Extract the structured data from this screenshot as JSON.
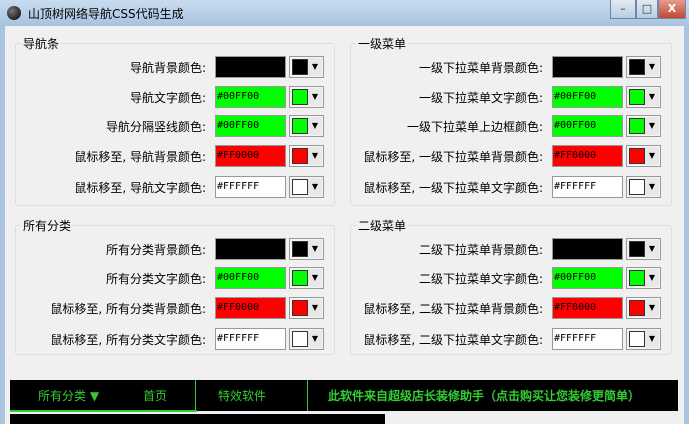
{
  "window": {
    "title": "山顶树网络导航CSS代码生成",
    "minimize": "–",
    "maximize": "□",
    "close": "X"
  },
  "groups": [
    {
      "title": "导航条",
      "rows": [
        {
          "label": "导航背景颜色:",
          "value": "",
          "color": "#000000",
          "text": "#000000"
        },
        {
          "label": "导航文字颜色:",
          "value": "#00FF00",
          "color": "#00FF00",
          "text": "#000000"
        },
        {
          "label": "导航分隔竖线颜色:",
          "value": "#00FF00",
          "color": "#00FF00",
          "text": "#000000"
        },
        {
          "label": "鼠标移至, 导航背景颜色:",
          "value": "#FF0000",
          "color": "#FF0000",
          "text": "#000000"
        },
        {
          "label": "鼠标移至, 导航文字颜色:",
          "value": "#FFFFFF",
          "color": "#FFFFFF",
          "text": "#000000"
        }
      ]
    },
    {
      "title": "一级菜单",
      "rows": [
        {
          "label": "一级下拉菜单背景颜色:",
          "value": "",
          "color": "#000000",
          "text": "#000000"
        },
        {
          "label": "一级下拉菜单文字颜色:",
          "value": "#00FF00",
          "color": "#00FF00",
          "text": "#000000"
        },
        {
          "label": "一级下拉菜单上边框颜色:",
          "value": "#00FF00",
          "color": "#00FF00",
          "text": "#000000"
        },
        {
          "label": "鼠标移至, 一级下拉菜单背景颜色:",
          "value": "#FF0000",
          "color": "#FF0000",
          "text": "#000000"
        },
        {
          "label": "鼠标移至, 一级下拉菜单文字颜色:",
          "value": "#FFFFFF",
          "color": "#FFFFFF",
          "text": "#000000"
        }
      ]
    },
    {
      "title": "所有分类",
      "rows": [
        {
          "label": "所有分类背景颜色:",
          "value": "",
          "color": "#000000",
          "text": "#000000"
        },
        {
          "label": "所有分类文字颜色:",
          "value": "#00FF00",
          "color": "#00FF00",
          "text": "#000000"
        },
        {
          "label": "鼠标移至, 所有分类背景颜色:",
          "value": "#FF0000",
          "color": "#FF0000",
          "text": "#000000"
        },
        {
          "label": "鼠标移至, 所有分类文字颜色:",
          "value": "#FFFFFF",
          "color": "#FFFFFF",
          "text": "#000000"
        }
      ]
    },
    {
      "title": "二级菜单",
      "rows": [
        {
          "label": "二级下拉菜单背景颜色:",
          "value": "",
          "color": "#000000",
          "text": "#000000"
        },
        {
          "label": "二级下拉菜单文字颜色:",
          "value": "#00FF00",
          "color": "#00FF00",
          "text": "#000000"
        },
        {
          "label": "鼠标移至, 二级下拉菜单背景颜色:",
          "value": "#FF0000",
          "color": "#FF0000",
          "text": "#000000"
        },
        {
          "label": "鼠标移至, 二级下拉菜单文字颜色:",
          "value": "#FFFFFF",
          "color": "#FFFFFF",
          "text": "#000000"
        }
      ]
    }
  ],
  "preview": {
    "all_categories": "所有分类 ▼",
    "home": "首页",
    "effects": "特效软件",
    "promo": "此软件来自超级店长装修助手（点击购买让您装修更简单）",
    "accent": "#33CC33"
  }
}
